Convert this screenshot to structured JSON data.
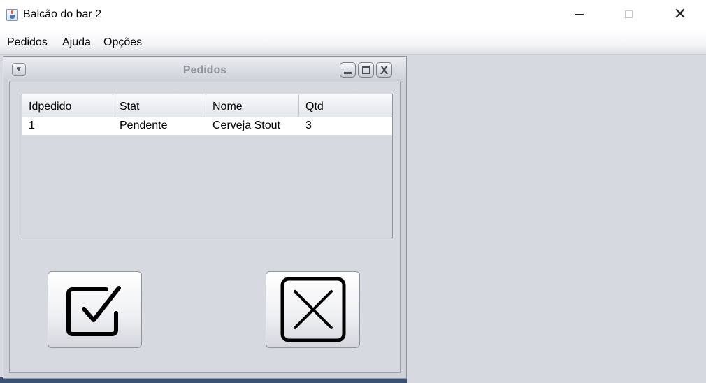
{
  "window": {
    "title": "Balcão do bar 2",
    "controls": {
      "minimize": "—",
      "maximize": "□",
      "close": "✕"
    }
  },
  "menubar": {
    "items": [
      {
        "label": "Pedidos"
      },
      {
        "label": "Ajuda"
      },
      {
        "label": "Opções"
      }
    ]
  },
  "internal_frame": {
    "title": "Pedidos",
    "controls": {
      "menu": "▼",
      "close": "X"
    },
    "table": {
      "columns": [
        "Idpedido",
        "Stat",
        "Nome",
        "Qtd"
      ],
      "rows": [
        [
          "1",
          "Pendente",
          "Cerveja Stout",
          "3"
        ]
      ]
    },
    "buttons": [
      {
        "icon": "checkbox-checked-icon"
      },
      {
        "icon": "close-box-icon"
      }
    ]
  },
  "colors": {
    "desktop_bg": "#d6d9df",
    "frame_title_text": "#8f949c",
    "row_bg": "#ffffff"
  }
}
